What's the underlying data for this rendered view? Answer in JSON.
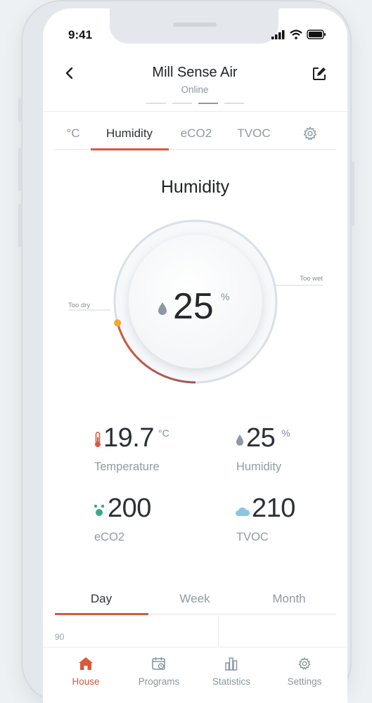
{
  "status_bar": {
    "time": "9:41"
  },
  "header": {
    "title": "Mill Sense Air",
    "subtitle": "Online"
  },
  "tabs": [
    {
      "label": "°C"
    },
    {
      "label": "Humidity",
      "active": true
    },
    {
      "label": "eCO2"
    },
    {
      "label": "TVOC"
    }
  ],
  "section": {
    "title": "Humidity"
  },
  "gauge": {
    "value": "25",
    "unit": "%",
    "level": 0.25,
    "label_low": "Too dry",
    "label_high": "Too wet"
  },
  "readings": [
    {
      "value": "19.7",
      "unit": "°C",
      "label": "Temperature",
      "icon": "thermometer-icon"
    },
    {
      "value": "25",
      "unit": "%",
      "label": "Humidity",
      "icon": "droplet-icon"
    },
    {
      "value": "200",
      "unit": "",
      "label": "eCO2",
      "icon": "co2-molecule-icon"
    },
    {
      "value": "210",
      "unit": "",
      "label": "TVOC",
      "icon": "cloud-icon"
    }
  ],
  "periods": [
    {
      "label": "Day",
      "active": true
    },
    {
      "label": "Week"
    },
    {
      "label": "Month"
    }
  ],
  "chart": {
    "y_tick": "90"
  },
  "bottom_nav": [
    {
      "label": "House",
      "icon": "house-icon",
      "active": true
    },
    {
      "label": "Programs",
      "icon": "calendar-icon"
    },
    {
      "label": "Statistics",
      "icon": "bar-chart-icon"
    },
    {
      "label": "Settings",
      "icon": "gear-icon"
    }
  ],
  "colors": {
    "accent": "#d85a3a",
    "gauge_arc_end": "#a05a5a",
    "knob": "#f0a830",
    "teal": "#3aa88a",
    "blue": "#8fc4e0"
  }
}
